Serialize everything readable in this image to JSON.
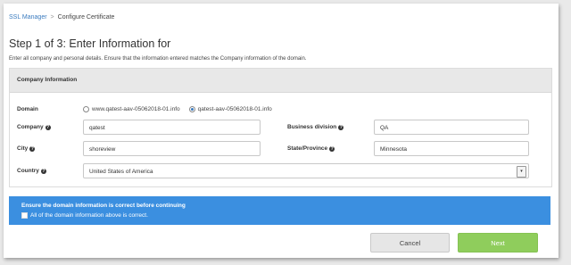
{
  "breadcrumb": {
    "root": "SSL Manager",
    "separator": ">",
    "current": "Configure Certificate"
  },
  "header": {
    "title": "Step 1 of 3: Enter Information for",
    "subtitle": "Enter all company and personal details. Ensure that the information entered matches the Company information of the domain."
  },
  "panel": {
    "title": "Company Information",
    "domain": {
      "label": "Domain",
      "options": [
        {
          "label": "www.qatest-aav-05062018-01.info",
          "selected": false
        },
        {
          "label": "qatest-aav-05062018-01.info",
          "selected": true
        }
      ]
    },
    "company": {
      "label": "Company",
      "value": "qatest"
    },
    "business_division": {
      "label": "Business division",
      "value": "QA"
    },
    "city": {
      "label": "City",
      "value": "shoreview"
    },
    "state": {
      "label": "State/Province",
      "value": "Minnesota"
    },
    "country": {
      "label": "Country",
      "value": "United States of America"
    }
  },
  "notice": {
    "title": "Ensure the domain information is correct before continuing",
    "checkbox_label": "All of the domain information above is correct.",
    "checked": false
  },
  "buttons": {
    "cancel": "Cancel",
    "next": "Next"
  },
  "colors": {
    "notice_bg": "#3b8fe0",
    "next_bg": "#8fcd5c",
    "link": "#3a7bbf"
  }
}
